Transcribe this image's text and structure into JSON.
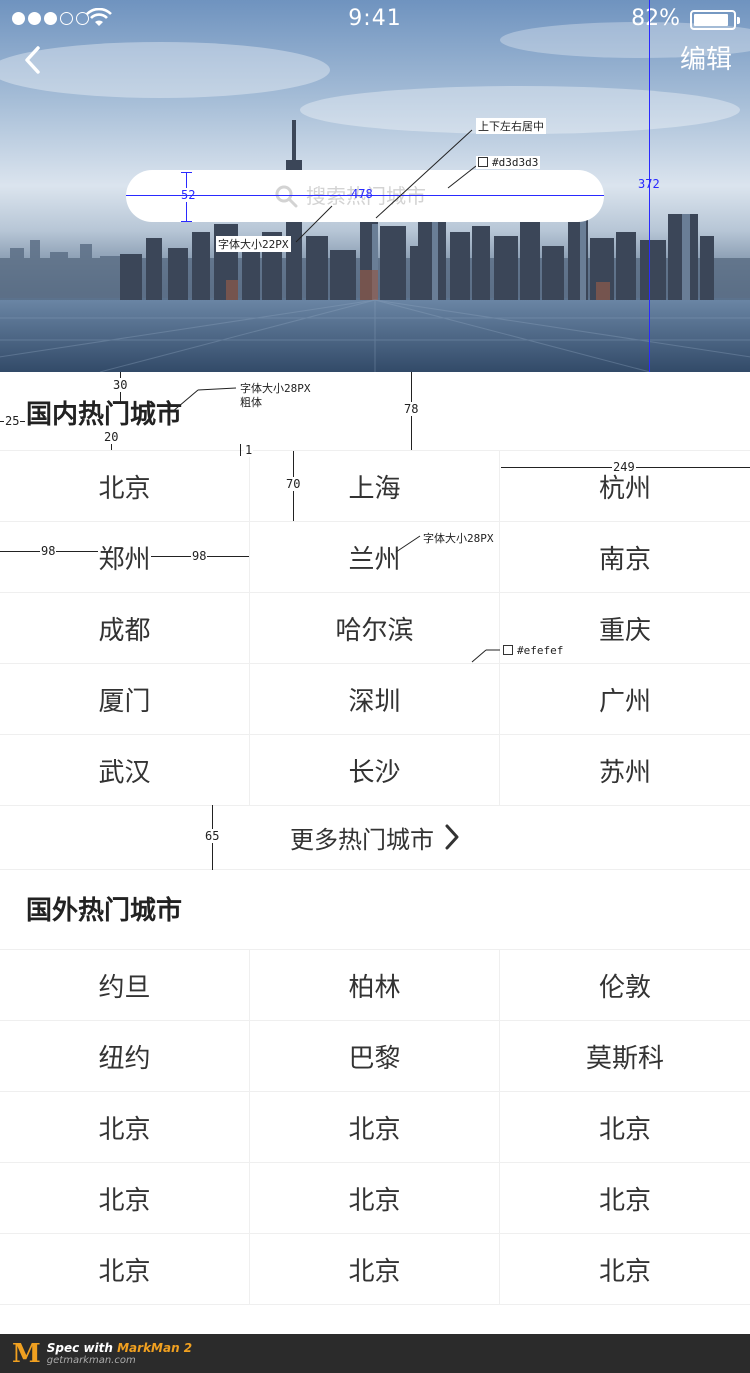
{
  "status_bar": {
    "time": "9:41",
    "battery": "82%",
    "battery_level": 0.82,
    "signal_bars_filled": 3,
    "signal_bars_total": 5
  },
  "header": {
    "back_icon": "chevron-left-icon",
    "edit_label": "编辑"
  },
  "search": {
    "icon": "search-icon",
    "placeholder": "搜索热门城市"
  },
  "domestic": {
    "title": "国内热门城市",
    "cities": [
      [
        "北京",
        "上海",
        "杭州"
      ],
      [
        "郑州",
        "兰州",
        "南京"
      ],
      [
        "成都",
        "哈尔滨",
        "重庆"
      ],
      [
        "厦门",
        "深圳",
        "广州"
      ],
      [
        "武汉",
        "长沙",
        "苏州"
      ]
    ],
    "more_label": "更多热门城市",
    "more_icon": "chevron-right-icon"
  },
  "foreign": {
    "title": "国外热门城市",
    "cities": [
      [
        "约旦",
        "柏林",
        "伦敦"
      ],
      [
        "纽约",
        "巴黎",
        "莫斯科"
      ],
      [
        "北京",
        "北京",
        "北京"
      ],
      [
        "北京",
        "北京",
        "北京"
      ],
      [
        "北京",
        "北京",
        "北京"
      ]
    ]
  },
  "annotations": {
    "search_height": "52",
    "search_width": "478",
    "hero_height": "372",
    "center_note": "上下左右居中",
    "search_color": "#d3d3d3",
    "search_font_note": "字体大小22PX",
    "spacing_30": "30",
    "title_font_note_1": "字体大小28PX",
    "title_font_note_2": "粗体",
    "left_25": "25",
    "spacing_20": "20",
    "line_1": "1",
    "header_78": "78",
    "row_70": "70",
    "cell_249": "249",
    "pad_98_left": "98",
    "pad_98_right": "98",
    "cell_font_note": "字体大小28PX",
    "divider_color": "#efefef",
    "more_65": "65"
  },
  "footer": {
    "spec_text": "Spec with",
    "brand": "MarkMan 2",
    "site": "getmarkman.com"
  },
  "colors": {
    "placeholder": "#d3d3d3",
    "divider": "#efefef",
    "text": "#333333"
  }
}
